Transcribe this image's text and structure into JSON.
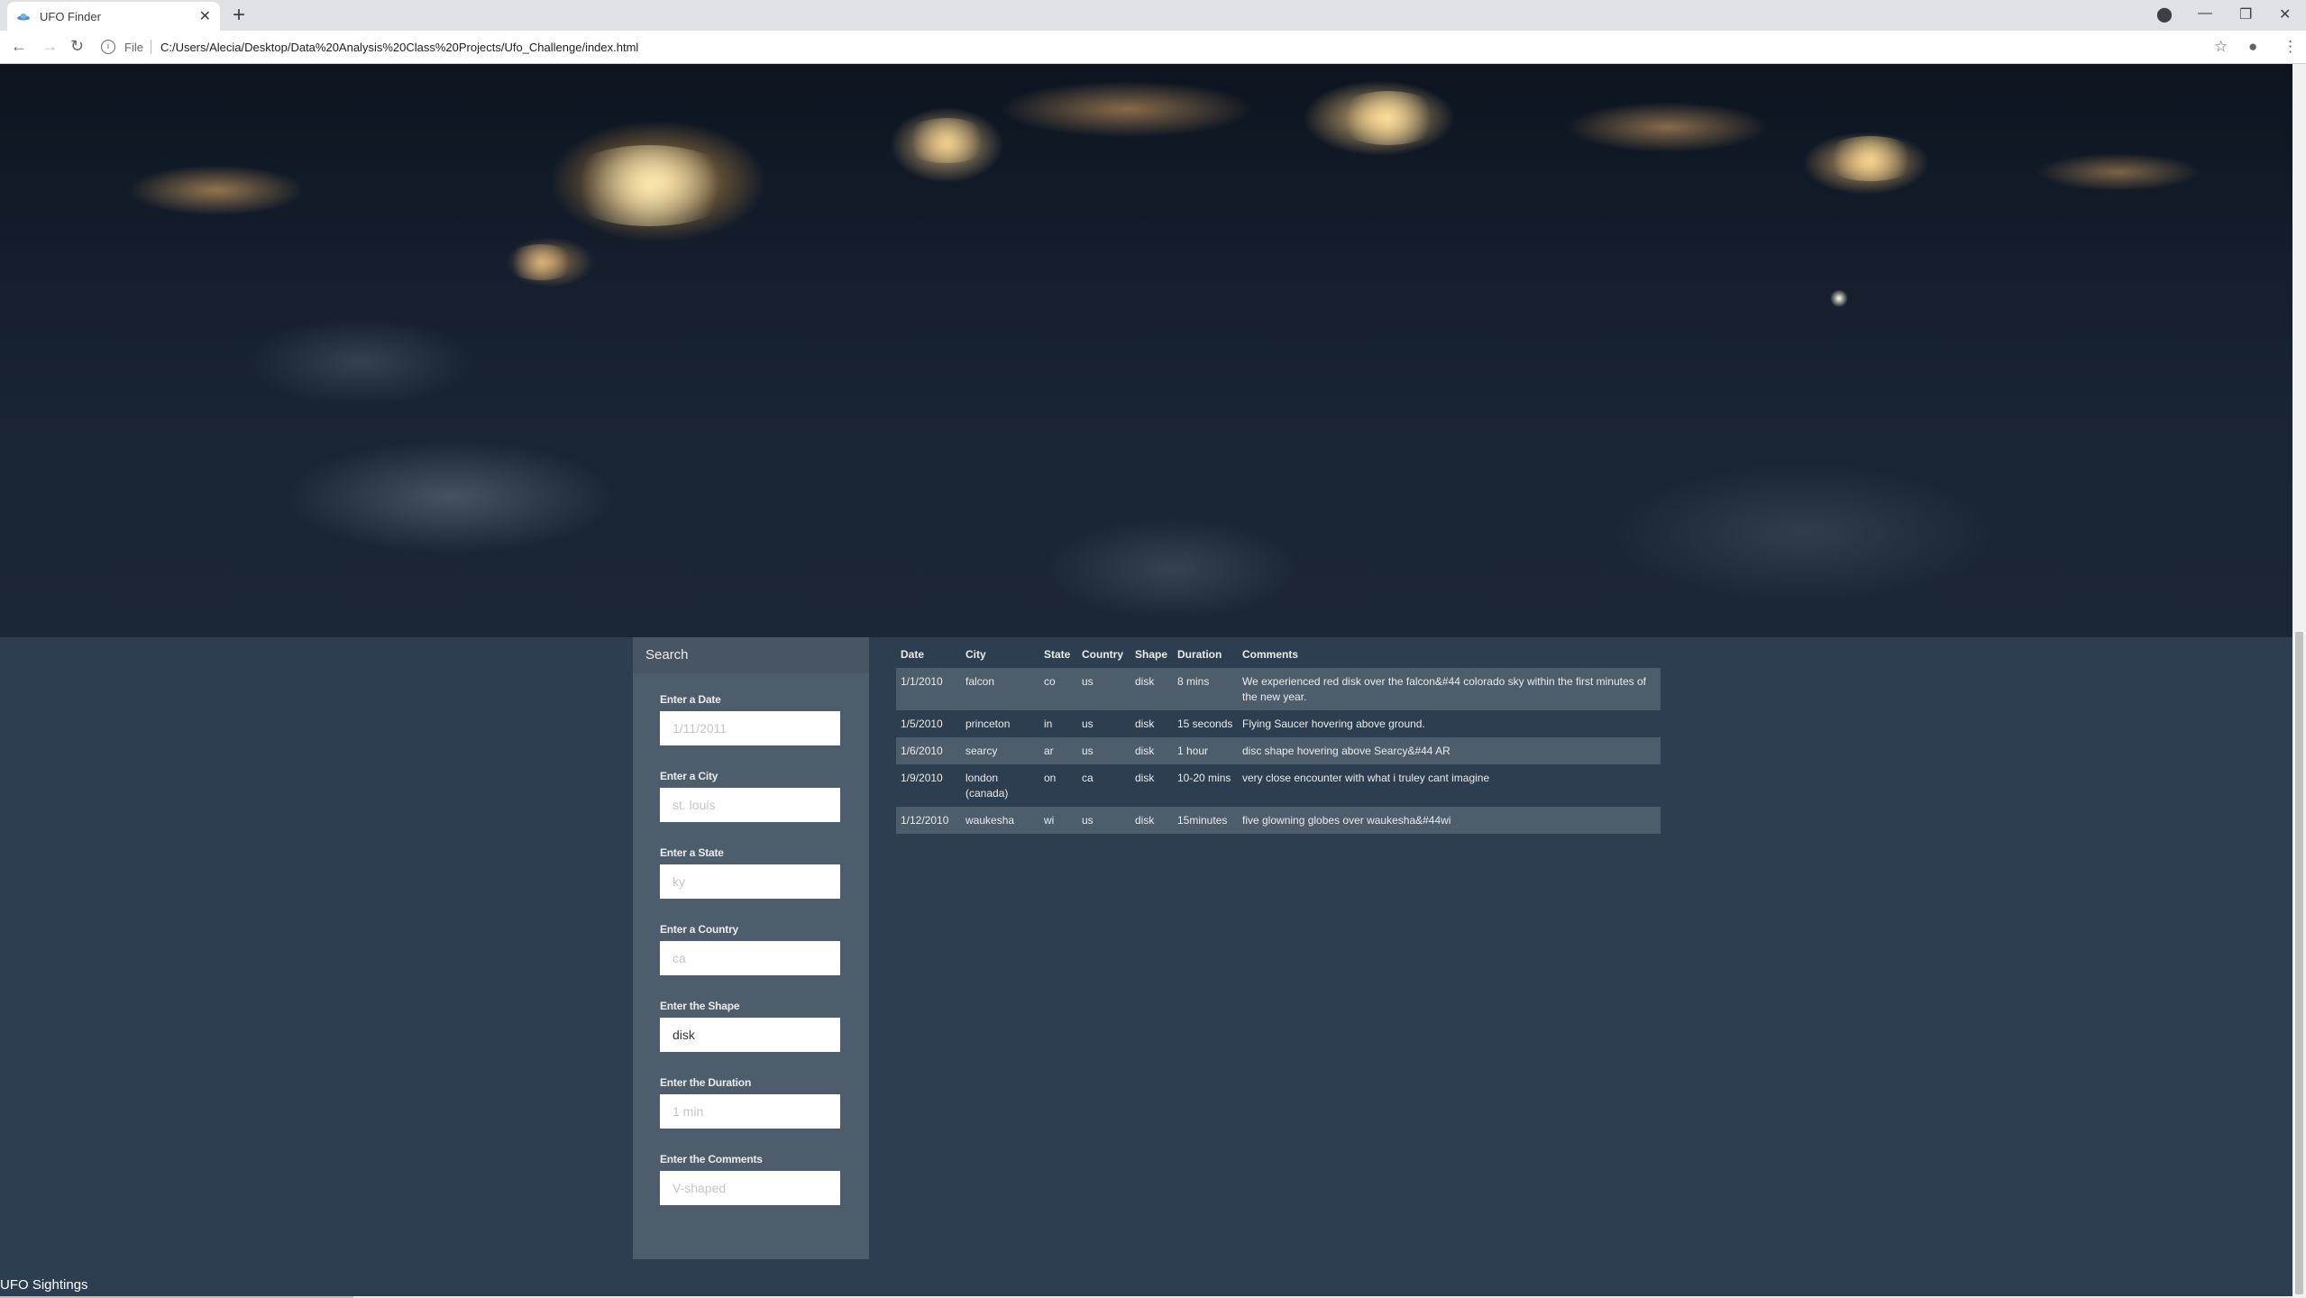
{
  "browser": {
    "tab_title": "UFO Finder",
    "new_tab": "+",
    "file_label": "File",
    "url": "C:/Users/Alecia/Desktop/Data%20Analysis%20Class%20Projects/Ufo_Challenge/index.html"
  },
  "panel": {
    "heading": "Search",
    "filters": [
      {
        "label": "Enter a Date",
        "placeholder": "1/11/2011",
        "value": ""
      },
      {
        "label": "Enter a City",
        "placeholder": "st. louis",
        "value": ""
      },
      {
        "label": "Enter a State",
        "placeholder": "ky",
        "value": ""
      },
      {
        "label": "Enter a Country",
        "placeholder": "ca",
        "value": ""
      },
      {
        "label": "Enter the Shape",
        "placeholder": "",
        "value": "disk"
      },
      {
        "label": "Enter the Duration",
        "placeholder": "1 min",
        "value": ""
      },
      {
        "label": "Enter the Comments",
        "placeholder": "V-shaped",
        "value": ""
      }
    ]
  },
  "table": {
    "columns": [
      "Date",
      "City",
      "State",
      "Country",
      "Shape",
      "Duration",
      "Comments"
    ],
    "rows": [
      [
        "1/1/2010",
        "falcon",
        "co",
        "us",
        "disk",
        "8 mins",
        "We experienced red disk over the falcon&#44 colorado sky within the first minutes of the new year."
      ],
      [
        "1/5/2010",
        "princeton",
        "in",
        "us",
        "disk",
        "15 seconds",
        "Flying Saucer hovering above ground."
      ],
      [
        "1/6/2010",
        "searcy",
        "ar",
        "us",
        "disk",
        "1 hour",
        "disc shape hovering above Searcy&#44 AR"
      ],
      [
        "1/9/2010",
        "london (canada)",
        "on",
        "ca",
        "disk",
        "10-20 mins",
        "very close encounter with what i truley cant imagine"
      ],
      [
        "1/12/2010",
        "waukesha",
        "wi",
        "us",
        "disk",
        "15minutes",
        "five glowning globes over waukesha&#44wi"
      ]
    ]
  },
  "footer": {
    "text": "UFO Sightings"
  },
  "colors": {
    "page_bg": "#2c3e50",
    "panel_bg": "#4e5d6c",
    "stripe": "#4e5d6c",
    "text": "#ebebeb"
  }
}
